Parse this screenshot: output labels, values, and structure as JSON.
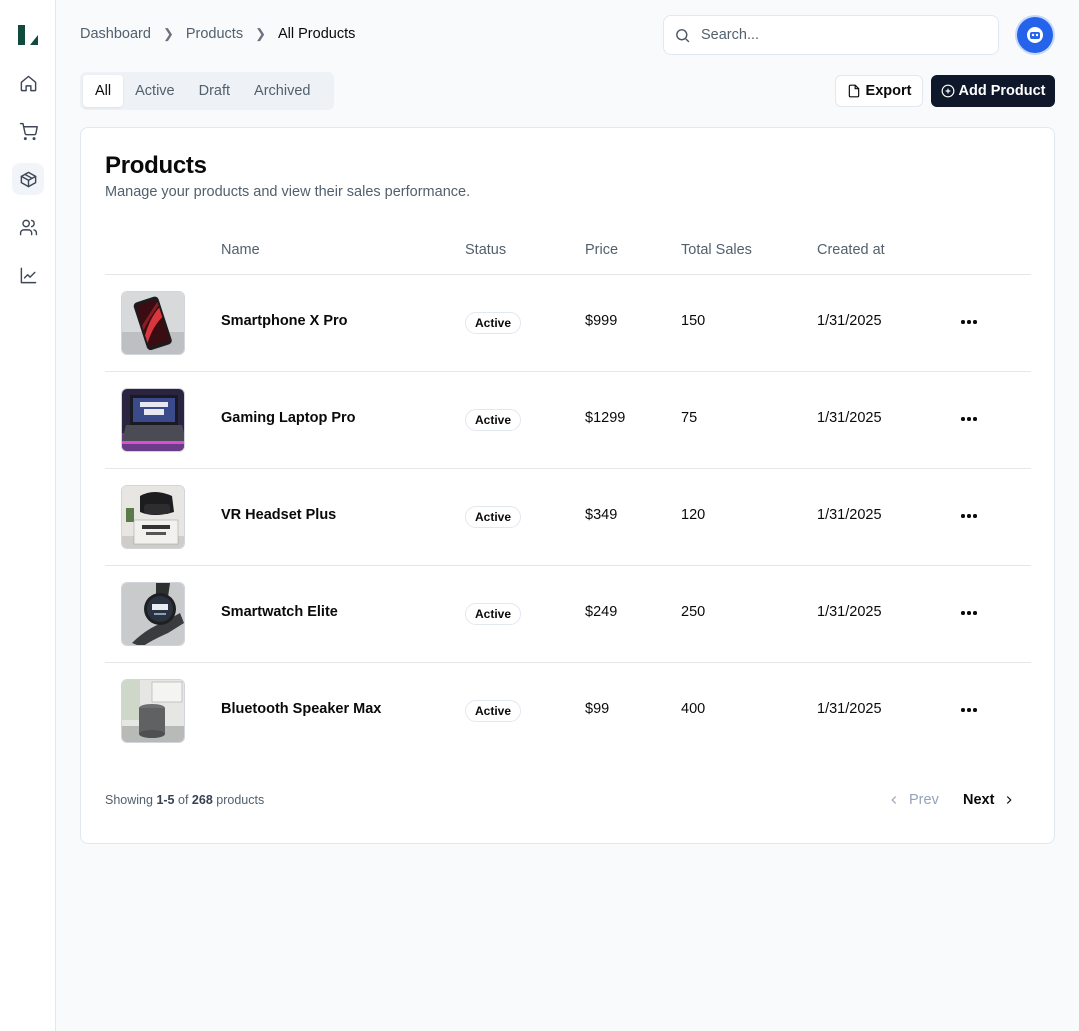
{
  "sidebar": {
    "logo": "L",
    "items": [
      {
        "icon": "home-icon",
        "label": "Dashboard"
      },
      {
        "icon": "cart-icon",
        "label": "Orders"
      },
      {
        "icon": "package-icon",
        "label": "Products",
        "active": true
      },
      {
        "icon": "users-icon",
        "label": "Customers"
      },
      {
        "icon": "chart-icon",
        "label": "Analytics"
      }
    ]
  },
  "header": {
    "breadcrumb": [
      "Dashboard",
      "Products",
      "All Products"
    ],
    "search_placeholder": "Search...",
    "avatar_icon": "user-avatar-icon"
  },
  "tabs": [
    "All",
    "Active",
    "Draft",
    "Archived"
  ],
  "toolbar": {
    "export_label": "Export",
    "add_label": "Add Product"
  },
  "card": {
    "title": "Products",
    "description": "Manage your products and view their sales performance."
  },
  "table": {
    "columns": {
      "name": "Name",
      "status": "Status",
      "price": "Price",
      "sales": "Total Sales",
      "created": "Created at"
    },
    "rows": [
      {
        "name": "Smartphone X Pro",
        "status": "Active",
        "price": "$999",
        "sales": "150",
        "created": "1/31/2025"
      },
      {
        "name": "Gaming Laptop Pro",
        "status": "Active",
        "price": "$1299",
        "sales": "75",
        "created": "1/31/2025"
      },
      {
        "name": "VR Headset Plus",
        "status": "Active",
        "price": "$349",
        "sales": "120",
        "created": "1/31/2025"
      },
      {
        "name": "Smartwatch Elite",
        "status": "Active",
        "price": "$249",
        "sales": "250",
        "created": "1/31/2025"
      },
      {
        "name": "Bluetooth Speaker Max",
        "status": "Active",
        "price": "$99",
        "sales": "400",
        "created": "1/31/2025"
      }
    ]
  },
  "pagination": {
    "showing_prefix": "Showing",
    "range": "1-5",
    "of": "of",
    "total": "268",
    "suffix": "products",
    "prev": "Prev",
    "next": "Next"
  },
  "colors": {
    "brand": "#114a3e",
    "primary": "#0f172a",
    "avatar": "#2563eb"
  }
}
